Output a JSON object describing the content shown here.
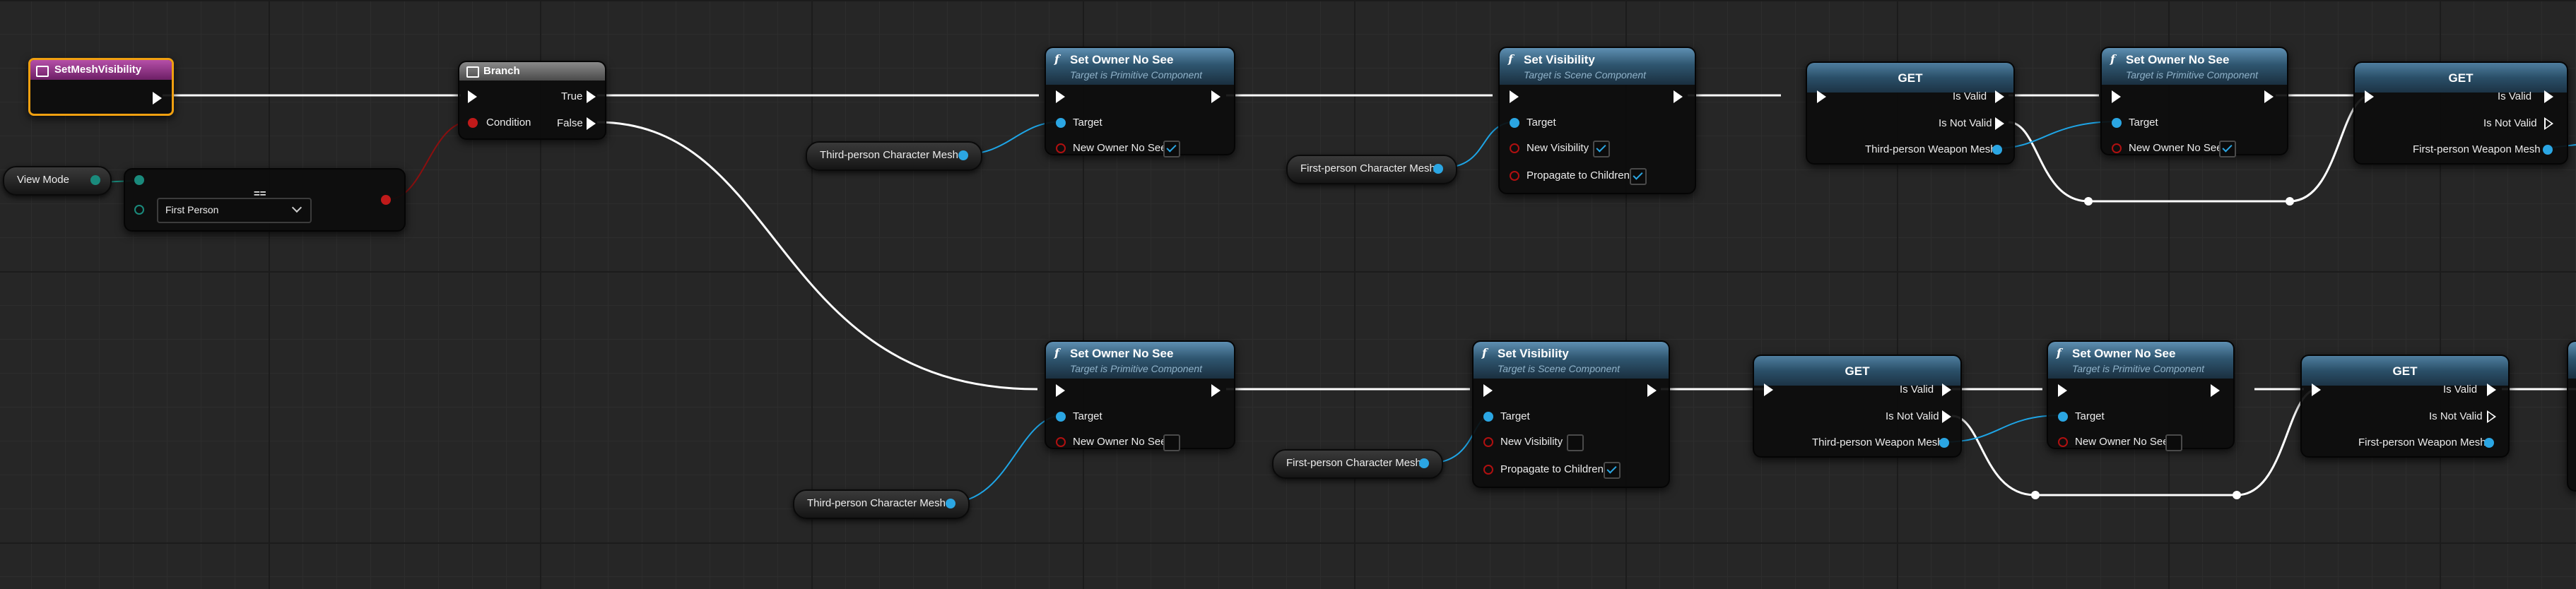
{
  "event": {
    "title": "SetMeshVisibility"
  },
  "branch": {
    "title": "Branch",
    "true_label": "True",
    "false_label": "False",
    "condition_label": "Condition"
  },
  "view_mode": {
    "label": "View Mode"
  },
  "select": {
    "title": "==",
    "value": "First Person"
  },
  "set_owner": {
    "title": "Set Owner No See",
    "subtitle": "Target is Primitive Component",
    "target_label": "Target",
    "param_label": "New Owner No See"
  },
  "set_vis": {
    "title": "Set Visibility",
    "subtitle": "Target is Scene Component",
    "target_label": "Target",
    "param_label": "New Visibility",
    "propagate_label": "Propagate to Children"
  },
  "get": {
    "title": "GET",
    "valid_label": "Is Valid",
    "not_valid_label": "Is Not Valid"
  },
  "vars": {
    "third_mesh": "Third-person Character Mesh",
    "first_mesh": "First-person Character Mesh",
    "third_weapon": "Third-person Weapon Mesh",
    "first_weapon": "First-person Weapon Mesh"
  },
  "checkboxes": {
    "top_owner_tp": true,
    "top_vis_fp": true,
    "top_prop_fp": true,
    "top_owner_w": true,
    "bot_owner_tp": false,
    "bot_vis_fp": false,
    "bot_prop_fp": true,
    "bot_owner_w": false
  },
  "colors": {
    "exec_wire": "#ffffff",
    "object_wire": "#1ea5e6",
    "bool_wire": "#8a0f0f",
    "node_header": "#2f5670",
    "event_header": "#9b2d8f",
    "event_border": "#f0a010"
  }
}
